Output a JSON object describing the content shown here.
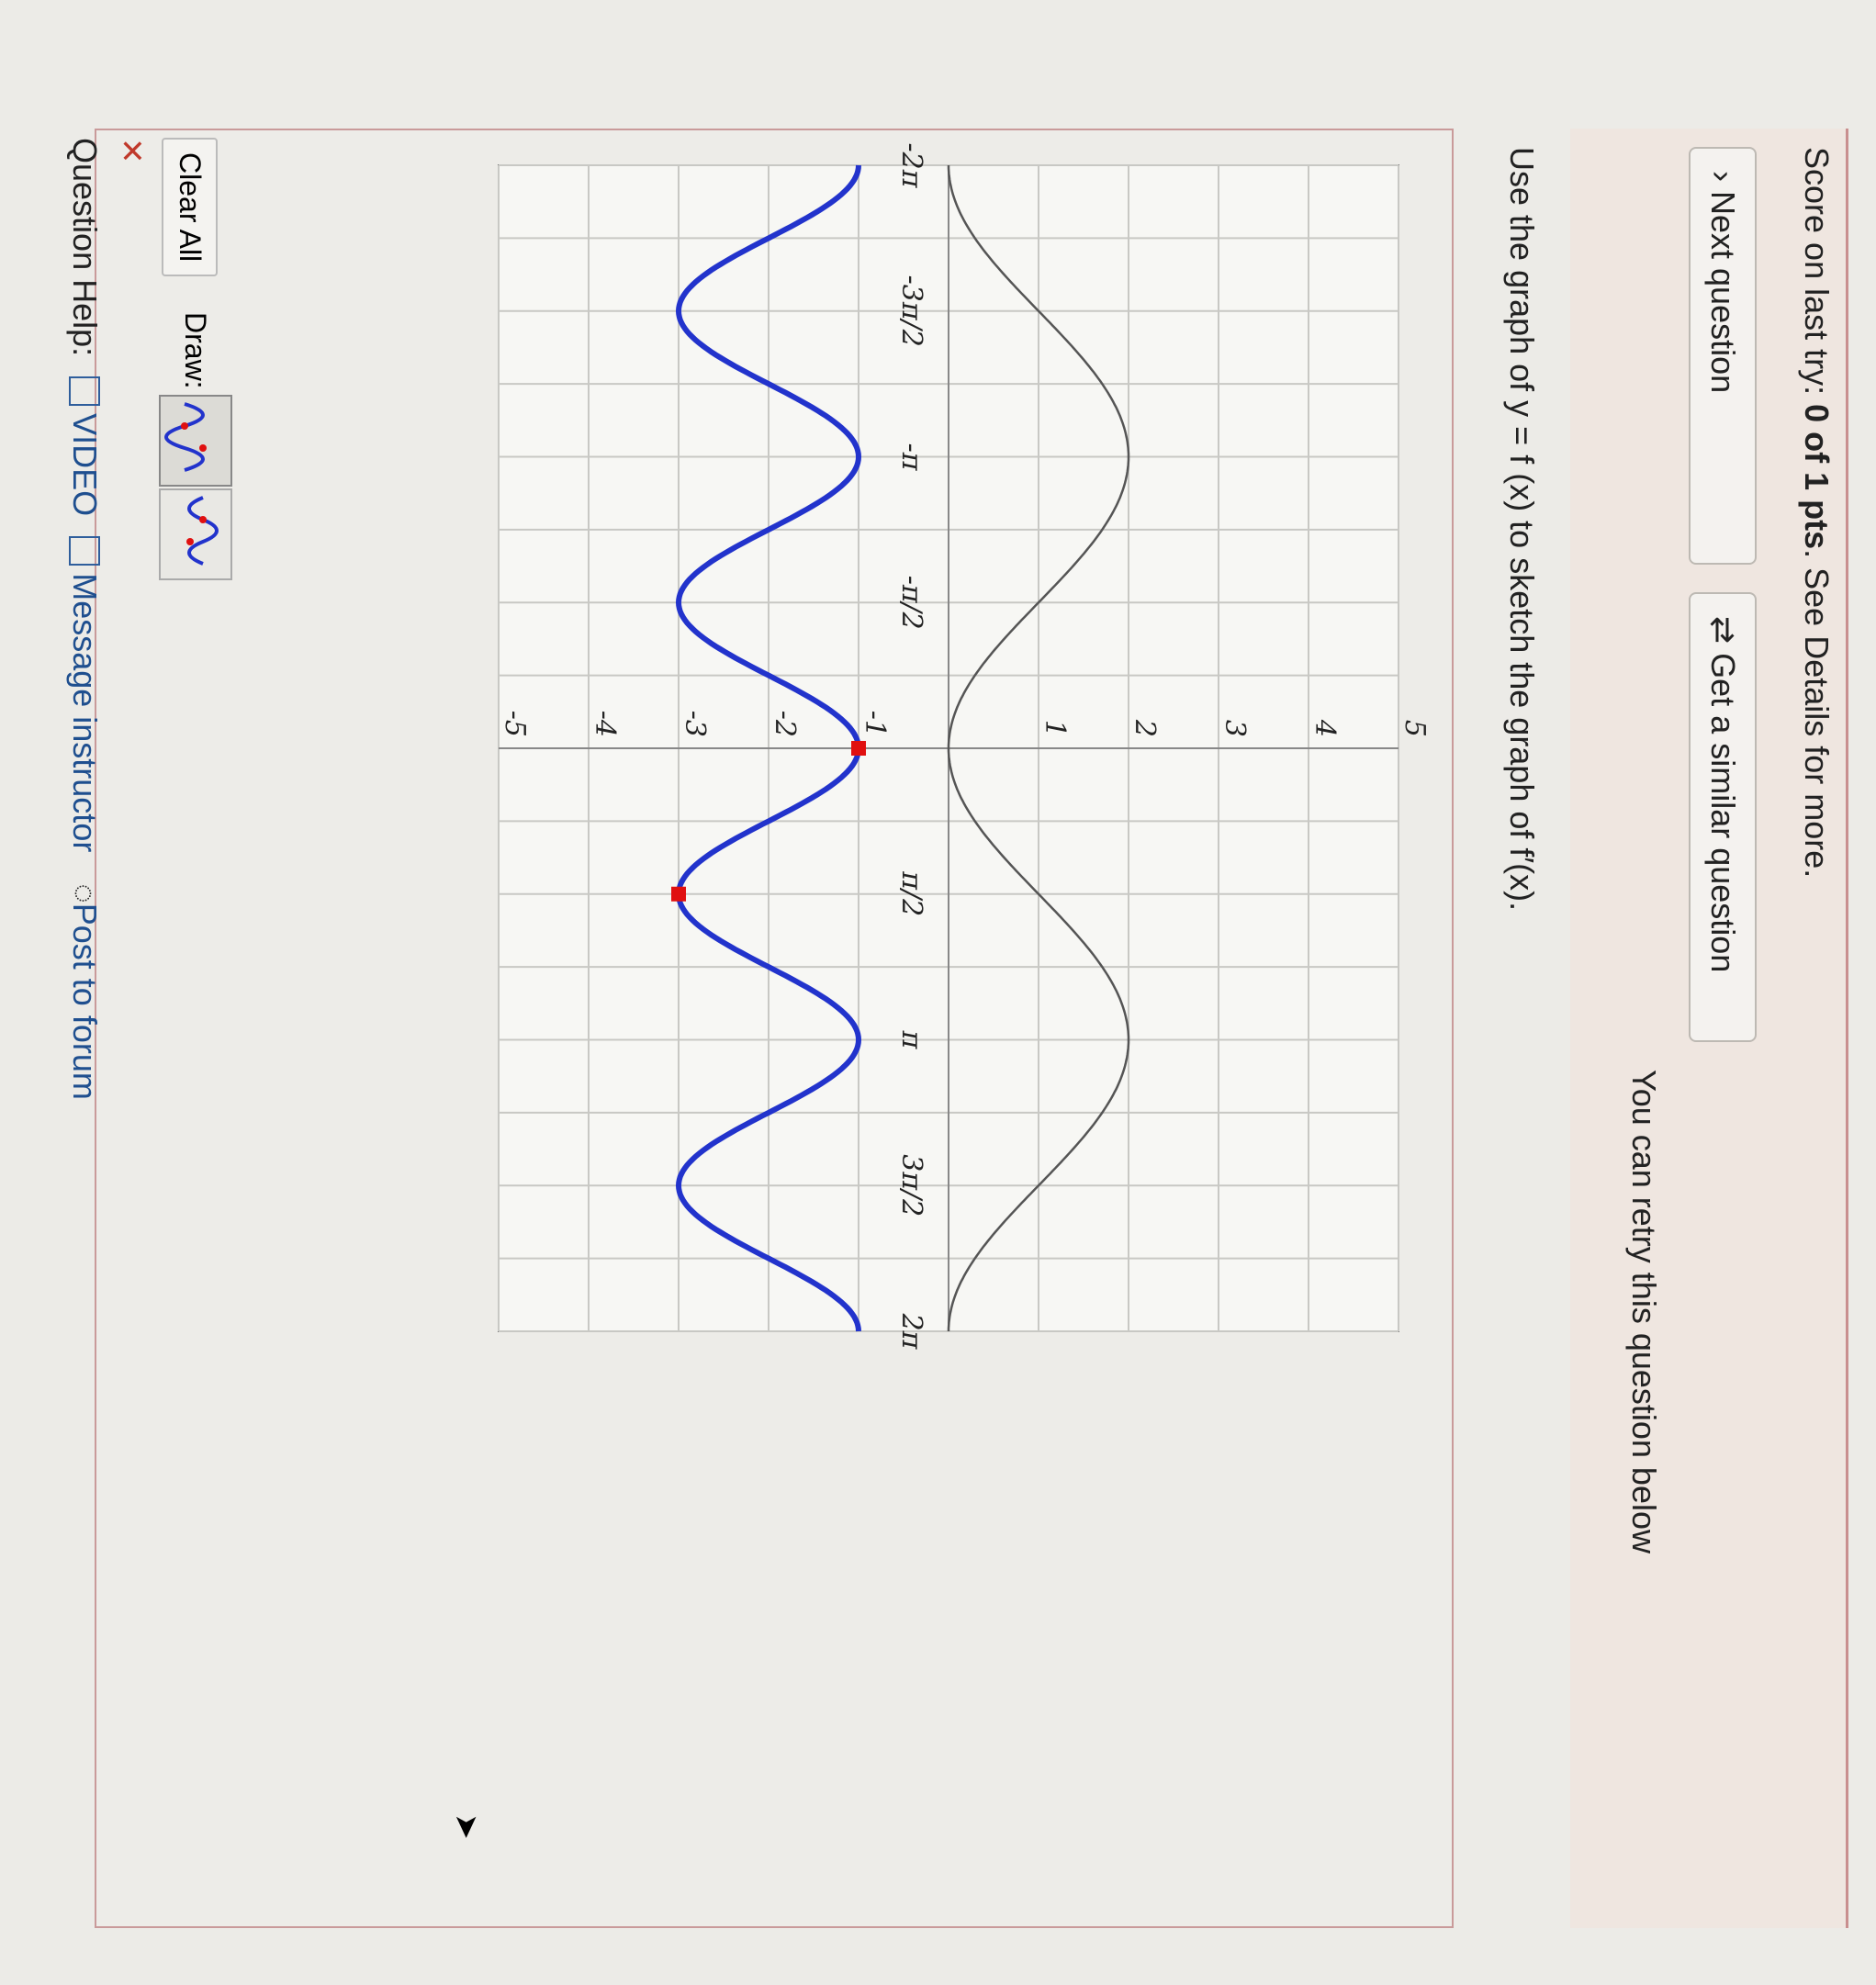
{
  "header": {
    "score_prefix": "Score on last try: ",
    "score_value": "0 of 1 pts",
    "score_suffix": ". See Details for more."
  },
  "buttons": {
    "next_label": "Next question",
    "similar_label": "Get a similar question",
    "retry_text": "You can retry this question below"
  },
  "question": {
    "prompt_text": "Use the graph of y = f (x) to sketch the graph of f′(x)."
  },
  "chart_data": {
    "type": "line",
    "xlim": [
      -6.2832,
      6.2832
    ],
    "ylim": [
      -5,
      5
    ],
    "x_tick_labels": [
      "-2π",
      "-3π/2",
      "-π",
      "-π/2",
      "π/2",
      "π",
      "3π/2",
      "2π"
    ],
    "x_tick_values": [
      -6.2832,
      -4.7124,
      -3.1416,
      -1.5708,
      1.5708,
      3.1416,
      4.7124,
      6.2832
    ],
    "y_tick_labels": [
      "5",
      "4",
      "3",
      "2",
      "1",
      "-1",
      "-2",
      "-3",
      "-4",
      "-5"
    ],
    "y_tick_values": [
      5,
      4,
      3,
      2,
      1,
      -1,
      -2,
      -3,
      -4,
      -5
    ],
    "grid": true,
    "series": [
      {
        "color": "#555555",
        "func": "given",
        "amplitude": 1,
        "period": 6.2832,
        "midline": 1,
        "points": [
          [
            -6.2832,
            0
          ],
          [
            -3.1416,
            2
          ],
          [
            0,
            0
          ],
          [
            3.1416,
            2
          ],
          [
            6.2832,
            0
          ]
        ]
      },
      {
        "color": "#2233cc",
        "func": "drawn",
        "amplitude": 1,
        "period": 3.1416,
        "midline": -2,
        "points": [
          [
            -6.2832,
            -1
          ],
          [
            -4.7124,
            -3
          ],
          [
            -3.1416,
            -1
          ],
          [
            -1.5708,
            -3
          ],
          [
            0,
            -1
          ],
          [
            1.5708,
            -3
          ],
          [
            3.1416,
            -1
          ],
          [
            4.7124,
            -3
          ],
          [
            6.2832,
            -1
          ]
        ]
      }
    ],
    "markers": [
      {
        "x": 0,
        "y": -1,
        "color": "#e01010"
      },
      {
        "x": 1.5708,
        "y": -3,
        "color": "#e01010"
      }
    ]
  },
  "toolbar": {
    "clear_label": "Clear All",
    "draw_label": "Draw:",
    "close_symbol": "✕"
  },
  "help": {
    "label": "Question Help:",
    "video": "VIDEO",
    "message": "Message instructor",
    "forum": "Post to forum"
  }
}
